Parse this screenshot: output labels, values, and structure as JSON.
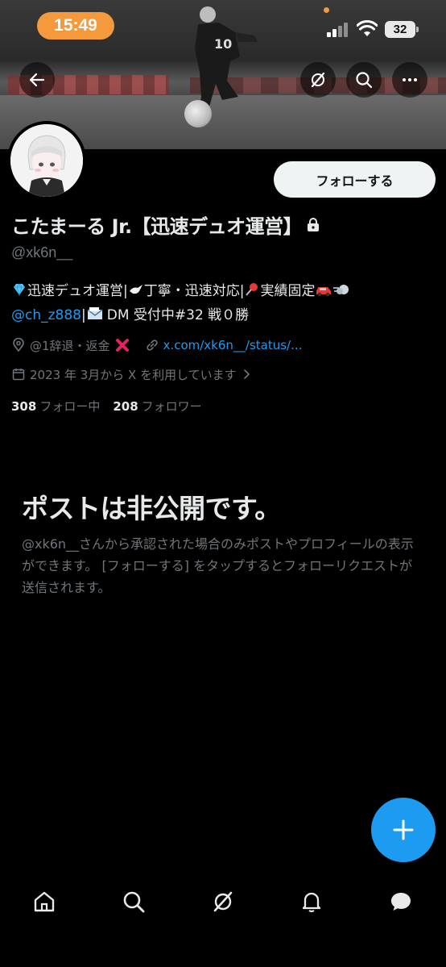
{
  "status_bar": {
    "time": "15:49",
    "battery": "32"
  },
  "banner_nav": {
    "back_icon": "arrow-left-icon",
    "grok_icon": "grok-slash-icon",
    "search_icon": "search-icon",
    "more_icon": "more-horizontal-icon"
  },
  "profile": {
    "display_name": "こたまーる Jr.【迅速デュオ運営】",
    "handle": "@xk6n__",
    "follow_label": "フォローする",
    "bio": {
      "line1_part1": "迅速デュオ運営|",
      "line1_part2": "丁寧・迅速対応|",
      "line1_part3": "実績固定",
      "mention": "@ch_z888",
      "line2_part2": "DM 受付中#32 戦０勝"
    },
    "location": "@1辞退・返金",
    "link": "x.com/xk6n__/status/...",
    "joined": "2023 年 3月から X を利用しています",
    "following_count": "308",
    "following_label": "フォロー中",
    "followers_count": "208",
    "followers_label": "フォロワー"
  },
  "private_notice": {
    "title": "ポストは非公開です。",
    "body": "@xk6n__さんから承認された場合のみポストやプロフィールの表示ができます。 [フォローする] をタップするとフォローリクエストが送信されます。"
  },
  "colors": {
    "background": "#000000",
    "accent": "#1d9bf0",
    "muted_text": "#71767b",
    "primary_text": "#e7e9ea",
    "time_pill": "#f59a3c"
  },
  "tab_bar": {
    "icons": [
      "home-icon",
      "search-icon",
      "grok-icon",
      "bell-icon",
      "messages-icon"
    ]
  },
  "fab": {
    "icon": "plus-icon"
  }
}
